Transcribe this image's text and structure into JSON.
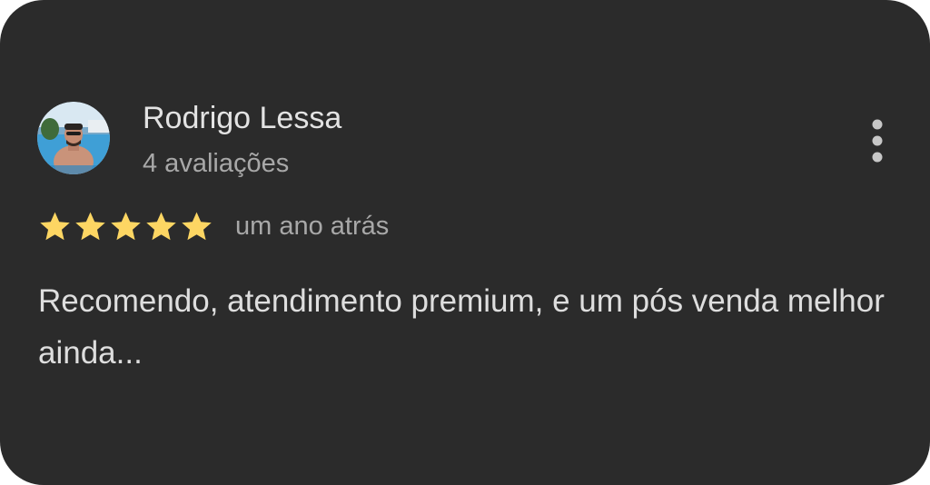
{
  "review": {
    "author_name": "Rodrigo Lessa",
    "author_review_count": "4 avaliações",
    "rating": 5,
    "rating_max": 5,
    "date": "um ano atrás",
    "text": "Recomendo, atendimento premium, e um pós venda melhor ainda..."
  },
  "icons": {
    "avatar": "profile-photo",
    "menu": "more-vert-icon",
    "star": "star-icon"
  },
  "colors": {
    "card_background": "#2b2b2b",
    "star": "#fdd663",
    "primary_text": "#e3e3e3",
    "secondary_text": "#a8a8a8"
  }
}
